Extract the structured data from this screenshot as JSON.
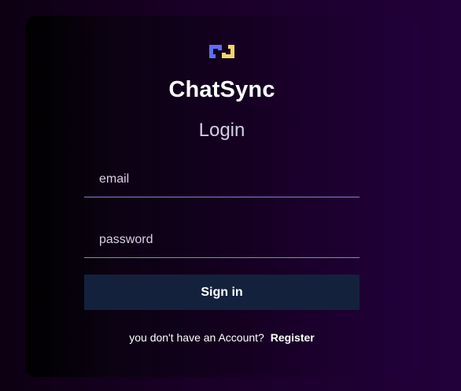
{
  "app": {
    "name": "ChatSync",
    "logo_icon": "chat-link-icon",
    "logo_colors": {
      "left": "#5d6ef0",
      "right": "#f3d66b"
    }
  },
  "login": {
    "heading": "Login",
    "email_placeholder": "email",
    "password_placeholder": "password",
    "submit_label": "Sign in",
    "footer_text": "you don't have an Account?",
    "register_label": "Register"
  },
  "theme": {
    "button_bg": "#14213d",
    "underline": "#8f7bd8"
  }
}
